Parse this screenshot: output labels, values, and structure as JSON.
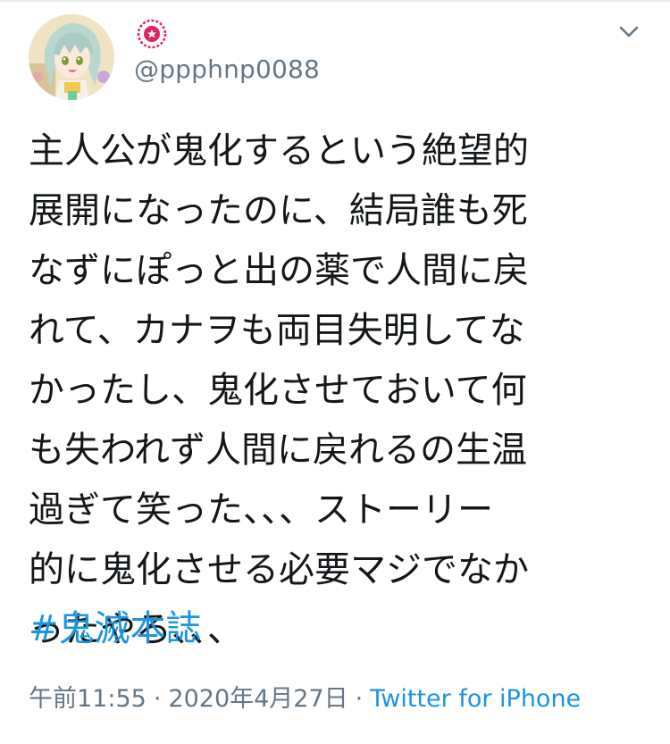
{
  "tweet": {
    "display_name_icon": "sakura-emblem-icon",
    "handle": "@ppphnp0088",
    "body": "主人公が鬼化するという絶望的\n展開になったのに、結局誰も死\nなずにぽっと出の薬で人間に戻\nれて、カナヲも両目失明してな\nかったし、鬼化させておいて何\nも失われず人間に戻れるの生温\n過ぎて笑った、、、ストーリー\n的に鬼化させる必要マジでなか\nったやろ、、、",
    "hashtag": "#鬼滅本誌",
    "time": "午前11:55",
    "separator": "·",
    "date": "2020年4月27日",
    "source": "Twitter for iPhone"
  },
  "icons": {
    "caret": "chevron-down-icon",
    "avatar": "anime-avatar"
  },
  "colors": {
    "text": "#14171a",
    "secondary": "#657786",
    "link": "#1b95e0",
    "emblem": "#e0245e"
  }
}
